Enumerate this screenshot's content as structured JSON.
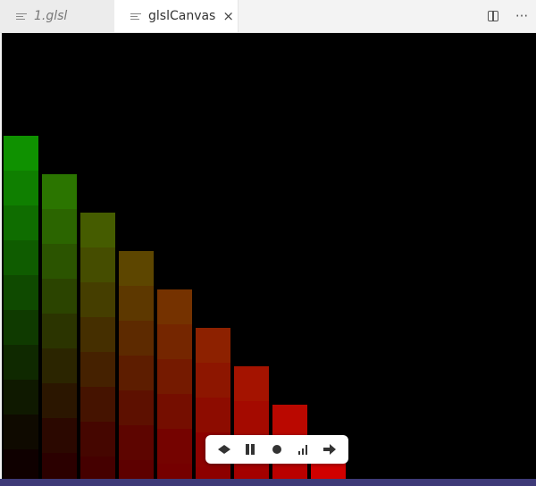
{
  "tabs": [
    {
      "label": "1.glsl",
      "active": false
    },
    {
      "label": "glslCanvas",
      "active": true
    }
  ],
  "tab_close_glyph": "×",
  "editor_actions": [
    {
      "icon": "split-editor-icon"
    },
    {
      "icon": "more-actions-icon",
      "glyph": "···"
    }
  ],
  "canvas_controls": [
    {
      "icon": "expand-icon"
    },
    {
      "icon": "pause-icon"
    },
    {
      "icon": "record-icon"
    },
    {
      "icon": "stats-icon"
    },
    {
      "icon": "next-icon"
    }
  ],
  "colors": {
    "statusbar": "#3e3a78",
    "canvas": "#000000"
  }
}
